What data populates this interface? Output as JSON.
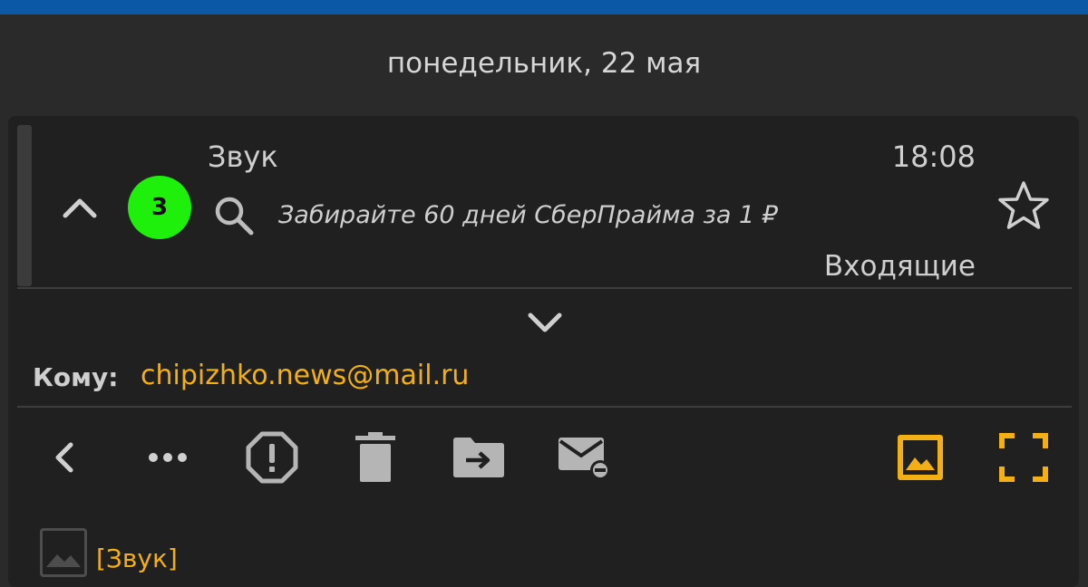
{
  "date_header": "понедельник, 22 мая",
  "message": {
    "sender": "Звук",
    "time": "18:08",
    "subject": "Забирайте 60 дней СберПрайма за 1 ₽",
    "folder": "Входящие",
    "thread_count": "3",
    "badge_color": "#1ef00b",
    "starred": false
  },
  "recipient": {
    "label": "Кому:",
    "email": "chipizhko.news@mail.ru"
  },
  "toolbar": {
    "icons": [
      "back-icon",
      "more-icon",
      "spam-icon",
      "delete-icon",
      "move-to-folder-icon",
      "mark-unread-icon",
      "show-images-icon",
      "fullscreen-icon"
    ],
    "accent_color": "#f3b014"
  },
  "attachment": {
    "label": "[Звук]"
  }
}
